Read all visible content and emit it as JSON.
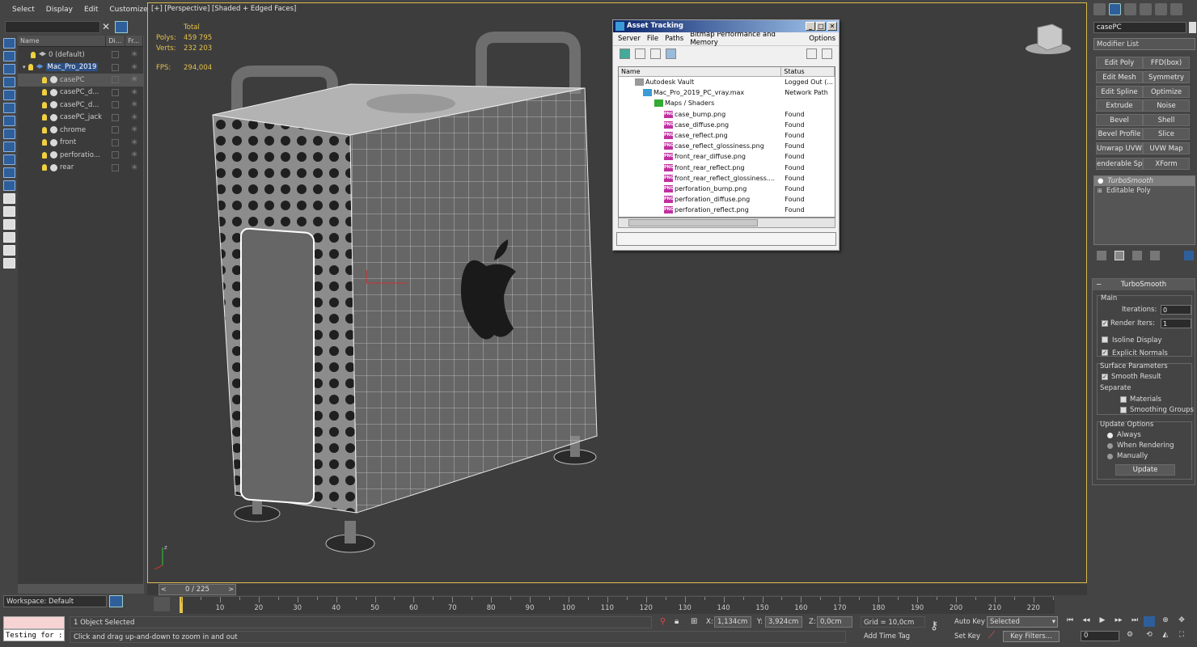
{
  "menu": {
    "select": "Select",
    "display": "Display",
    "edit": "Edit",
    "customize": "Customize"
  },
  "scene_explorer": {
    "col_name": "Name",
    "col_display": "Di...",
    "col_freeze": "Fr...",
    "rows": [
      {
        "label": "0 (default)"
      },
      {
        "label": "Mac_Pro_2019"
      },
      {
        "label": "casePC"
      },
      {
        "label": "casePC_d..."
      },
      {
        "label": "casePC_d..."
      },
      {
        "label": "casePC_jack"
      },
      {
        "label": "chrome"
      },
      {
        "label": "front"
      },
      {
        "label": "perforatio..."
      },
      {
        "label": "rear"
      }
    ]
  },
  "workspace": {
    "label": "Workspace: Default"
  },
  "viewport": {
    "label": "[+] [Perspective] [Shaded + Edged Faces]",
    "stats": {
      "total": "Total",
      "polys_label": "Polys:",
      "polys": "459 795",
      "verts_label": "Verts:",
      "verts": "232 203",
      "fps_label": "FPS:",
      "fps": "294,004"
    }
  },
  "asset_tracking": {
    "title": "Asset Tracking",
    "menu": [
      "Server",
      "File",
      "Paths",
      "Bitmap Performance and Memory",
      "Options"
    ],
    "col_name": "Name",
    "col_status": "Status",
    "rows": [
      {
        "name": "Autodesk Vault",
        "status": "Logged Out (..."
      },
      {
        "name": "Mac_Pro_2019_PC_vray.max",
        "status": "Network Path"
      },
      {
        "name": "Maps / Shaders",
        "status": ""
      },
      {
        "name": "case_bump.png",
        "status": "Found"
      },
      {
        "name": "case_diffuse.png",
        "status": "Found"
      },
      {
        "name": "case_reflect.png",
        "status": "Found"
      },
      {
        "name": "case_reflect_glossiness.png",
        "status": "Found"
      },
      {
        "name": "front_rear_diffuse.png",
        "status": "Found"
      },
      {
        "name": "front_rear_reflect.png",
        "status": "Found"
      },
      {
        "name": "front_rear_reflect_glossiness....",
        "status": "Found"
      },
      {
        "name": "perforation_bump.png",
        "status": "Found"
      },
      {
        "name": "perforation_diffuse.png",
        "status": "Found"
      },
      {
        "name": "perforation_reflect.png",
        "status": "Found"
      }
    ]
  },
  "command_panel": {
    "object_name": "casePC",
    "modifier_list": "Modifier List",
    "buttons": [
      "Edit Poly",
      "FFD(box)",
      "Edit Mesh",
      "Symmetry",
      "Edit Spline",
      "Optimize",
      "Extrude",
      "Noise",
      "Bevel",
      "Shell",
      "Bevel Profile",
      "Slice",
      "Unwrap UVW",
      "UVW Map",
      "enderable Splin",
      "XForm"
    ],
    "stack": [
      "TurboSmooth",
      "Editable Poly"
    ],
    "turbosmooth": {
      "title": "TurboSmooth",
      "main": "Main",
      "iterations_label": "Iterations:",
      "iterations": "0",
      "render_iters_label": "Render Iters:",
      "render_iters": "1",
      "isoline": "Isoline Display",
      "explicit": "Explicit Normals",
      "surface": "Surface Parameters",
      "smooth_result": "Smooth Result",
      "separate": "Separate",
      "materials": "Materials",
      "smoothing_groups": "Smoothing Groups",
      "update_options": "Update Options",
      "always": "Always",
      "when_rendering": "When Rendering",
      "manually": "Manually",
      "update": "Update"
    }
  },
  "timeline": {
    "frame": "0 / 225",
    "ticks": [
      "10",
      "20",
      "30",
      "40",
      "50",
      "60",
      "70",
      "80",
      "90",
      "100",
      "110",
      "120",
      "130",
      "140",
      "150",
      "160",
      "170",
      "180",
      "190",
      "200",
      "210",
      "220"
    ]
  },
  "status": {
    "maxscript": "Testing for :",
    "selection": "1 Object Selected",
    "prompt": "Click and drag up-and-down to zoom in and out",
    "x_label": "X:",
    "x": "1,134cm",
    "y_label": "Y:",
    "y": "3,924cm",
    "z_label": "Z:",
    "z": "0,0cm",
    "grid": "Grid = 10,0cm",
    "add_time_tag": "Add Time Tag",
    "auto_key": "Auto Key",
    "selected": "Selected",
    "set_key": "Set Key",
    "key_filters": "Key Filters...",
    "current_frame": "0"
  },
  "colors": {
    "accent": "#2f5f9a",
    "viewport_border": "#d9b94c",
    "stats": "#e6c14a"
  }
}
